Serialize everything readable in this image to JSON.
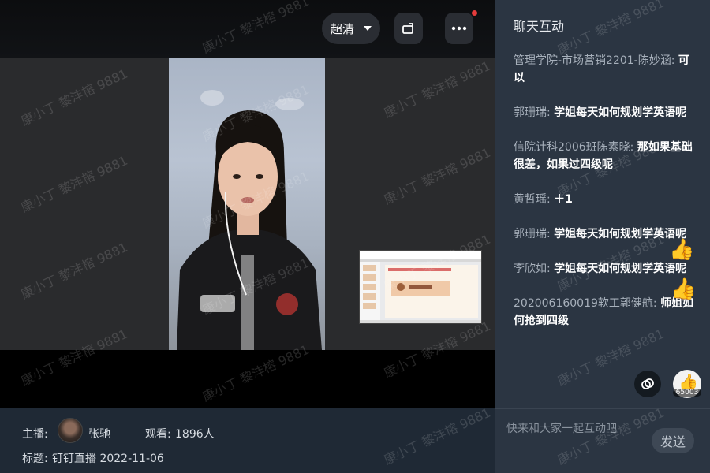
{
  "player": {
    "quality_label": "超清",
    "icons": {
      "quality": "chevron-down-icon",
      "rotate": "rotate-screen-icon",
      "more": "more-dots-icon"
    },
    "colors": {
      "notify_dot": "#e53b3b"
    }
  },
  "info": {
    "host_label": "主播:",
    "host_name": "张驰",
    "viewers_label": "观看:",
    "viewers_value": "1896人",
    "title_label": "标题:",
    "title_value": "钉钉直播 2022-11-06"
  },
  "chat": {
    "title": "聊天互动",
    "messages": [
      {
        "name": "管理学院-市场营销2201-陈妙涵: ",
        "text": "可以"
      },
      {
        "name": "郭珊瑞: ",
        "text": "学姐每天如何规划学英语呢"
      },
      {
        "name": "信院计科2006班陈素晓: ",
        "text": "那如果基础很差，如果过四级呢"
      },
      {
        "name": "黄哲瑶: ",
        "text": "＋1"
      },
      {
        "name": "郭珊瑞: ",
        "text": "学姐每天如何规划学英语呢"
      },
      {
        "name": "李欣如: ",
        "text": "学姐每天如何规划学英语呢"
      },
      {
        "name": "202006160019软工郭健航: ",
        "text": "师姐如何抢到四级"
      }
    ],
    "like_count": "65003",
    "input_placeholder": "快来和大家一起互动吧",
    "send_label": "发送",
    "icons": {
      "link": "link-icon",
      "like": "thumbs-up-icon"
    }
  },
  "watermark": {
    "text": "康小丁 黎沣榕 9881"
  }
}
